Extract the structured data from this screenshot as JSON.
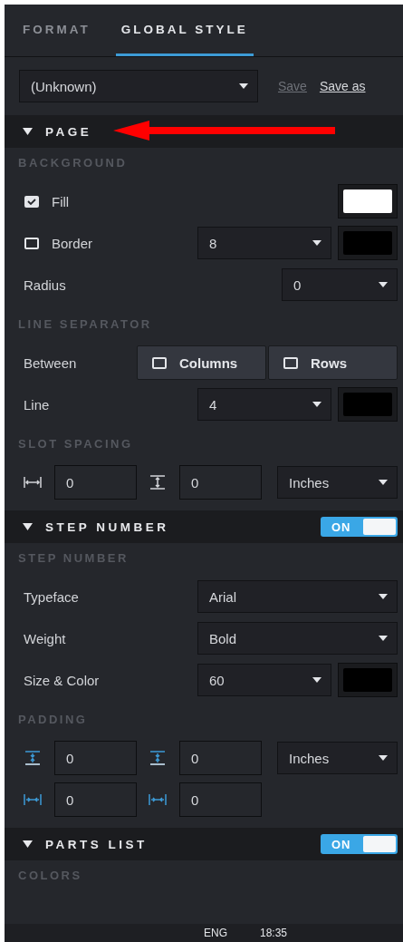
{
  "tabs": [
    {
      "label": "FORMAT",
      "selected": false
    },
    {
      "label": "GLOBAL STYLE",
      "selected": true
    }
  ],
  "preset": {
    "value": "(Unknown)"
  },
  "actions": [
    {
      "label": "Save",
      "disabled": true
    },
    {
      "label": "Save as",
      "disabled": false
    }
  ],
  "sections": [
    {
      "title": "PAGE",
      "expanded": true,
      "groups": [
        {
          "heading": "BACKGROUND",
          "rows": [
            {
              "kind": "check",
              "label": "Fill",
              "checked": true,
              "color": "#ffffff"
            },
            {
              "kind": "check",
              "label": "Border",
              "checked": false,
              "select": "8",
              "color": "#000000"
            },
            {
              "kind": "short",
              "label": "Radius",
              "select": "0"
            }
          ]
        },
        {
          "heading": "LINE SEPARATOR",
          "rows": [
            {
              "kind": "toggles",
              "label": "Between",
              "options": [
                {
                  "label": "Columns",
                  "checked": false
                },
                {
                  "label": "Rows",
                  "checked": false
                }
              ]
            },
            {
              "kind": "select",
              "label": "Line",
              "select": "4",
              "color": "#000000"
            }
          ]
        },
        {
          "heading": "SLOT SPACING",
          "rows": [
            {
              "kind": "spacing",
              "fields": [
                {
                  "kind": "width",
                  "value": "0"
                },
                {
                  "kind": "height",
                  "value": "0"
                }
              ],
              "unit": "Inches"
            }
          ]
        }
      ]
    },
    {
      "title": "STEP NUMBER",
      "expanded": true,
      "toggle": {
        "label": "ON",
        "on": true
      },
      "groups": [
        {
          "heading": "STEP NUMBER",
          "rows": [
            {
              "kind": "select",
              "label": "Typeface",
              "select": "Arial"
            },
            {
              "kind": "select",
              "label": "Weight",
              "select": "Bold"
            },
            {
              "kind": "select",
              "label": "Size & Color",
              "select": "60",
              "color": "#000000"
            }
          ]
        },
        {
          "heading": "PADDING",
          "rows": [
            {
              "kind": "spacing",
              "fields": [
                {
                  "kind": "pad-top",
                  "value": "0"
                },
                {
                  "kind": "pad-bottom",
                  "value": "0"
                }
              ],
              "unit": "Inches"
            },
            {
              "kind": "spacing",
              "fields": [
                {
                  "kind": "pad-left",
                  "value": "0"
                },
                {
                  "kind": "pad-right",
                  "value": "0"
                }
              ]
            }
          ]
        }
      ]
    },
    {
      "title": "PARTS LIST",
      "expanded": true,
      "toggle": {
        "label": "ON",
        "on": true
      },
      "groups": [
        {
          "heading": "COLORS"
        }
      ]
    }
  ],
  "taskbar": {
    "language": "ENG",
    "time": "18:35"
  }
}
